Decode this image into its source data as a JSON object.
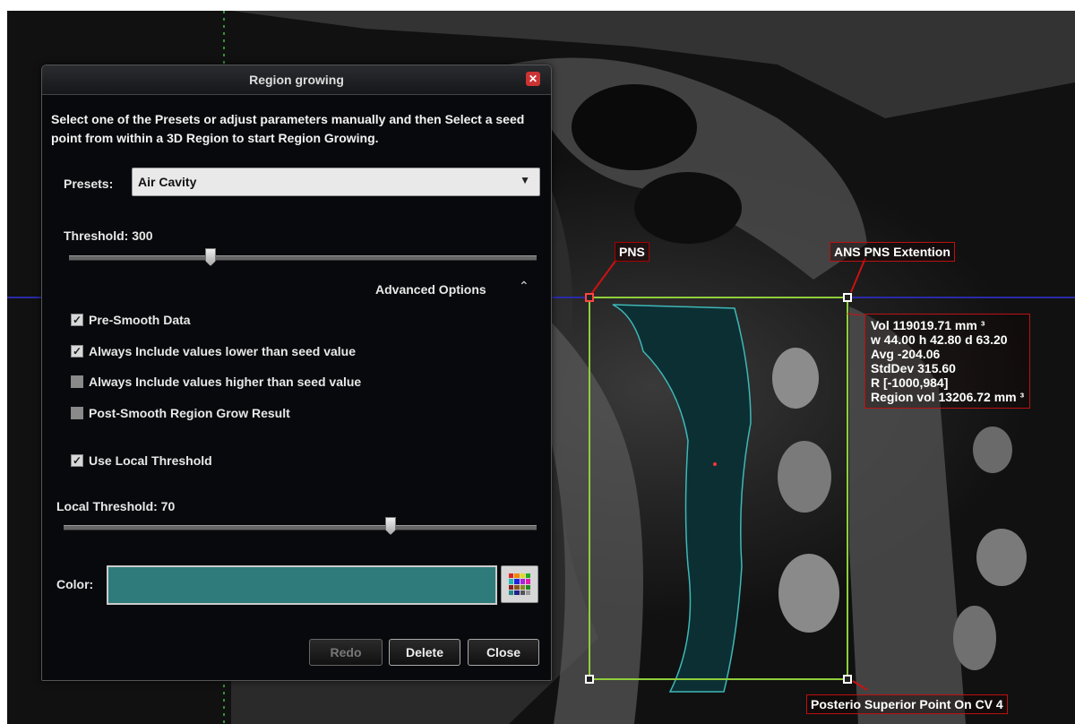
{
  "dialog": {
    "title": "Region growing",
    "instructions": "Select one of the Presets or adjust parameters manually and then Select a seed point from within a 3D Region to start Region Growing.",
    "presets_label": "Presets:",
    "presets_value": "Air Cavity",
    "threshold_label": "Threshold: 300",
    "threshold_value": 300,
    "advanced_options_label": "Advanced Options",
    "checkboxes": [
      {
        "label": "Pre-Smooth Data",
        "checked": true
      },
      {
        "label": "Always Include values lower than seed value",
        "checked": true
      },
      {
        "label": "Always Include values higher than seed value",
        "checked": false
      },
      {
        "label": "Post-Smooth Region Grow Result",
        "checked": false
      },
      {
        "label": "Use Local Threshold",
        "checked": true
      }
    ],
    "local_threshold_label": "Local Threshold: 70",
    "local_threshold_value": 70,
    "color_label": "Color:",
    "color_value": "#2f7b7c",
    "buttons": {
      "redo": "Redo",
      "delete": "Delete",
      "close": "Close"
    }
  },
  "overlay": {
    "pns_label": "PNS",
    "ans_label": "ANS PNS Extention",
    "cv4_label": "Posterio Superior Point On CV 4",
    "stats": [
      "Vol 119019.71 mm ³",
      "w 44.00 h 42.80 d 63.20",
      "Avg -204.06",
      "StdDev 315.60",
      "R [-1000,984]",
      "Region vol 13206.72 mm ³"
    ]
  },
  "colors": {
    "box_outline": "#8fce3a",
    "crosshair_h": "#2a2aa8",
    "crosshair_v": "#3fbf3f",
    "annotation_red": "#cc1111",
    "region_fill": "#0c2f33",
    "region_outline": "#3fb7b7"
  }
}
